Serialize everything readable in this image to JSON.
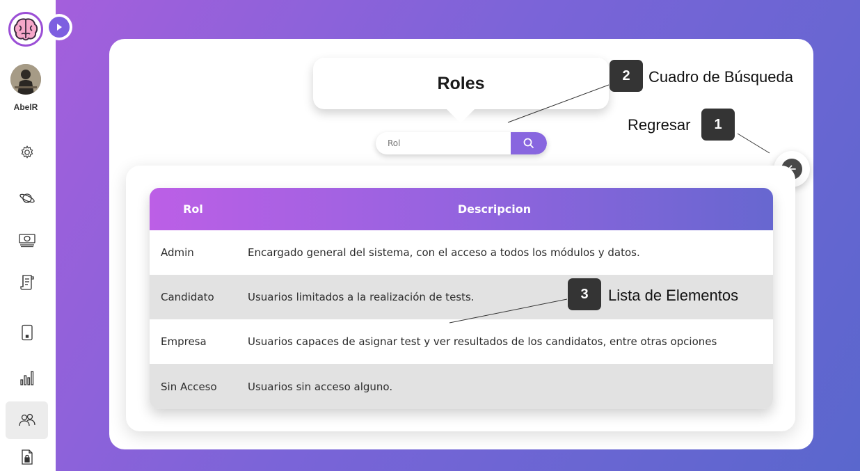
{
  "user": {
    "name": "AbelR"
  },
  "page": {
    "title": "Roles"
  },
  "search": {
    "placeholder": "Rol"
  },
  "table": {
    "columns": [
      "Rol",
      "Descripcion"
    ],
    "rows": [
      {
        "rol": "Admin",
        "descripcion": "Encargado general del sistema, con el acceso a todos los módulos y datos."
      },
      {
        "rol": "Candidato",
        "descripcion": "Usuarios limitados a la realización de tests."
      },
      {
        "rol": "Empresa",
        "descripcion": "Usuarios capaces de asignar test y ver resultados de los candidatos, entre otras opciones"
      },
      {
        "rol": "Sin Acceso",
        "descripcion": "Usuarios sin acceso alguno."
      }
    ]
  },
  "callouts": [
    {
      "number": "1",
      "label": "Regresar"
    },
    {
      "number": "2",
      "label": "Cuadro de Búsqueda"
    },
    {
      "number": "3",
      "label": "Lista de Elementos"
    }
  ],
  "sidebar": {
    "items": [
      {
        "icon": "gear-icon"
      },
      {
        "icon": "planet-icon"
      },
      {
        "icon": "money-icon"
      },
      {
        "icon": "document-icon"
      },
      {
        "icon": "mobile-icon"
      },
      {
        "icon": "bar-chart-icon"
      },
      {
        "icon": "users-icon",
        "active": true
      },
      {
        "icon": "file-lock-icon"
      }
    ]
  },
  "colors": {
    "accent": "#8866df",
    "gradient_start": "#a45fdc",
    "gradient_end": "#5a67cd",
    "badge": "#343434"
  }
}
